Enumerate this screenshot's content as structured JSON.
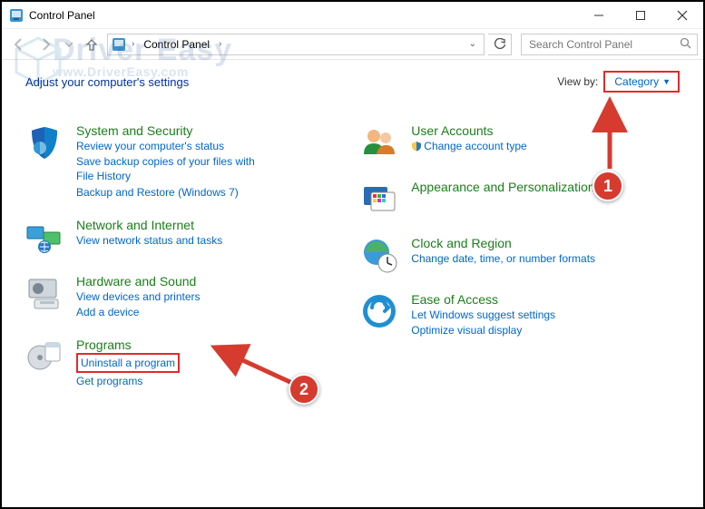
{
  "window": {
    "title": "Control Panel"
  },
  "breadcrumb": {
    "segment1": "Control Panel",
    "search_placeholder": "Search Control Panel"
  },
  "header": {
    "adjust_label": "Adjust your computer's settings",
    "viewby_label": "View by:",
    "viewby_value": "Category"
  },
  "left": {
    "security": {
      "title": "System and Security",
      "sub1": "Review your computer's status",
      "sub2": "Save backup copies of your files with File History",
      "sub3": "Backup and Restore (Windows 7)"
    },
    "network": {
      "title": "Network and Internet",
      "sub1": "View network status and tasks"
    },
    "hardware": {
      "title": "Hardware and Sound",
      "sub1": "View devices and printers",
      "sub2": "Add a device"
    },
    "programs": {
      "title": "Programs",
      "sub1": "Uninstall a program",
      "sub2": "Get programs"
    }
  },
  "right": {
    "users": {
      "title": "User Accounts",
      "sub1": "Change account type"
    },
    "appearance": {
      "title": "Appearance and Personalization"
    },
    "clock": {
      "title": "Clock and Region",
      "sub1": "Change date, time, or number formats"
    },
    "ease": {
      "title": "Ease of Access",
      "sub1": "Let Windows suggest settings",
      "sub2": "Optimize visual display"
    }
  },
  "annotations": {
    "badge1": "1",
    "badge2": "2"
  },
  "watermark": {
    "line1": "Driver Easy",
    "line2": "www.DriverEasy.com"
  }
}
